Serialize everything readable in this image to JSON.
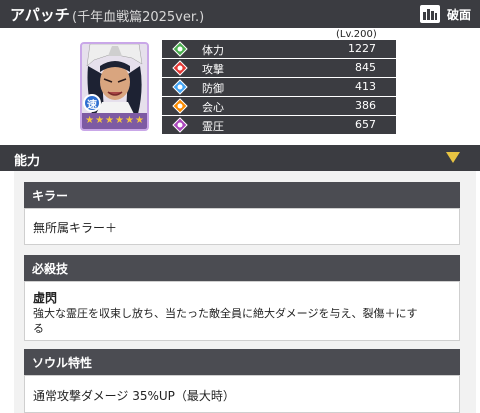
{
  "header": {
    "name": "アパッチ",
    "variant": "(千年血戦篇2025ver.)",
    "action_label": "破面"
  },
  "character": {
    "attribute_badge": "速",
    "stars": 6,
    "level_label": "(Lv.200)"
  },
  "stats": [
    {
      "name": "体力",
      "value": "1227",
      "color": "#4caf50",
      "icon": "health-icon"
    },
    {
      "name": "攻撃",
      "value": "845",
      "color": "#e53935",
      "icon": "attack-icon"
    },
    {
      "name": "防御",
      "value": "413",
      "color": "#42a5f5",
      "icon": "defense-icon"
    },
    {
      "name": "会心",
      "value": "386",
      "color": "#fb8c00",
      "icon": "critical-icon"
    },
    {
      "name": "霊圧",
      "value": "657",
      "color": "#ab47bc",
      "icon": "spirit-pressure-icon"
    }
  ],
  "section": {
    "title": "能力"
  },
  "killer": {
    "title": "キラー",
    "text": "無所属キラー＋"
  },
  "special": {
    "title": "必殺技",
    "name": "虚閃",
    "line1": "強大な霊圧を収束し放ち、当たった敵全員に絶大ダメージを与え、裂傷＋にす",
    "line2": "る"
  },
  "soul": {
    "title": "ソウル特性",
    "text": "通常攻撃ダメージ 35%UP（最大時）"
  }
}
